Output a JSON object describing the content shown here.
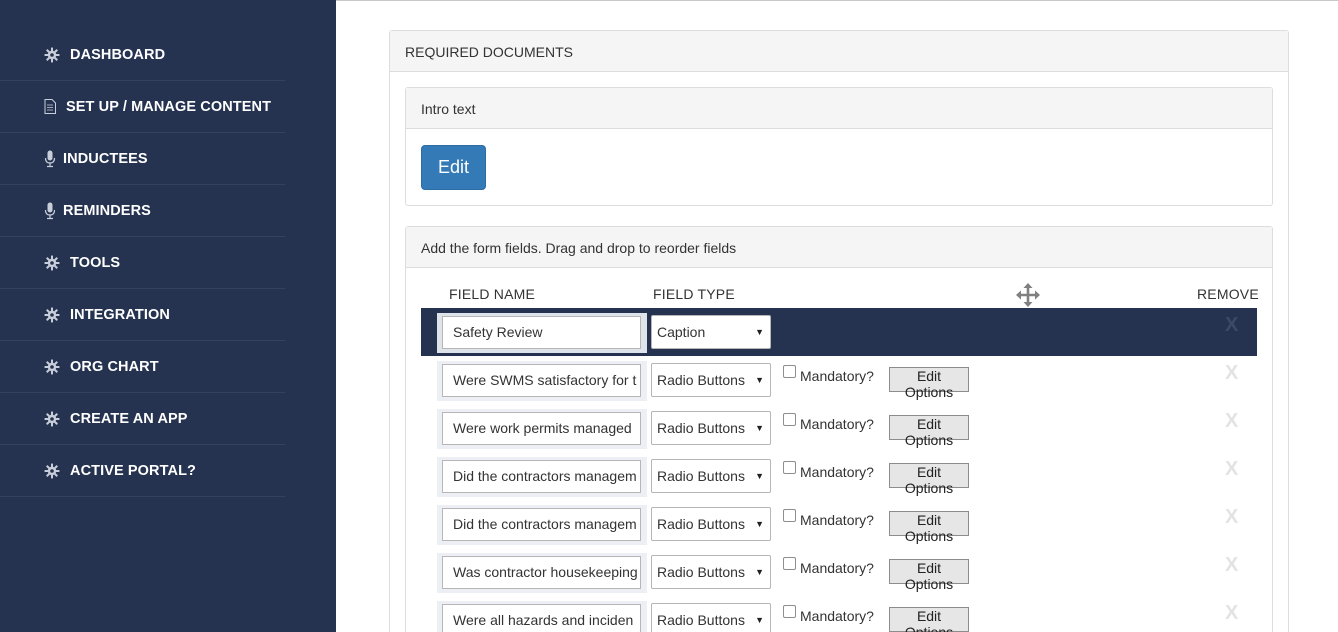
{
  "sidebar": {
    "items": [
      {
        "label": "DASHBOARD",
        "icon": "gear-icon"
      },
      {
        "label": "SET UP / MANAGE CONTENT",
        "icon": "document-icon"
      },
      {
        "label": "INDUCTEES",
        "icon": "microphone-icon"
      },
      {
        "label": "REMINDERS",
        "icon": "microphone-icon"
      },
      {
        "label": "TOOLS",
        "icon": "gear-icon"
      },
      {
        "label": "INTEGRATION",
        "icon": "gear-icon"
      },
      {
        "label": "ORG CHART",
        "icon": "gear-icon"
      },
      {
        "label": "CREATE AN APP",
        "icon": "gear-icon"
      },
      {
        "label": "ACTIVE PORTAL?",
        "icon": "gear-icon"
      }
    ]
  },
  "main": {
    "panel_title": "REQUIRED DOCUMENTS",
    "intro": {
      "title": "Intro text",
      "edit_label": "Edit"
    },
    "fields_panel": {
      "title": "Add the form fields. Drag and drop to reorder fields",
      "col_field_name": "FIELD NAME",
      "col_field_type": "FIELD TYPE",
      "col_remove": "REMOVE",
      "mandatory_label": "Mandatory?",
      "edit_options_label": "Edit Options",
      "remove_label": "X",
      "rows": [
        {
          "name": "Safety Review",
          "type": "Caption",
          "selected": true
        },
        {
          "name": "Were SWMS satisfactory for t",
          "type": "Radio Buttons"
        },
        {
          "name": "Were work permits managed",
          "type": "Radio Buttons"
        },
        {
          "name": "Did the contractors managem",
          "type": "Radio Buttons"
        },
        {
          "name": "Did the contractors managem",
          "type": "Radio Buttons"
        },
        {
          "name": "Was contractor housekeeping",
          "type": "Radio Buttons"
        },
        {
          "name": "Were all hazards and inciden",
          "type": "Radio Buttons"
        }
      ]
    }
  },
  "colors": {
    "sidebar_bg": "#253350",
    "primary_button": "#337ab7",
    "selected_row": "#253350"
  }
}
